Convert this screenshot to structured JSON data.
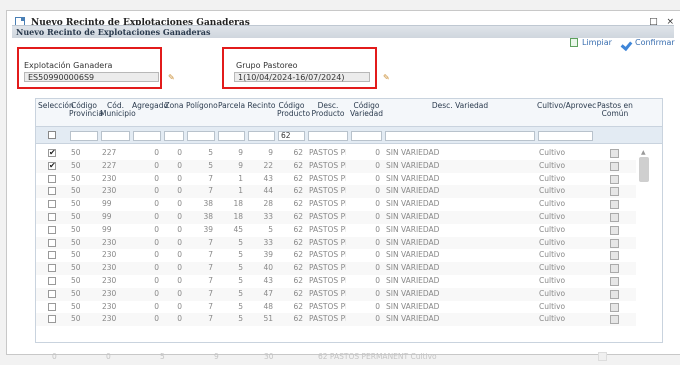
{
  "window": {
    "title": "Nuevo Recinto de Explotaciones Ganaderas",
    "controls": "_ □ ×"
  },
  "toolbar": {
    "title": "Nuevo Recinto de Explotaciones Ganaderas",
    "limpiar_label": "Limpiar",
    "confirmar_label": "Confirmar"
  },
  "form": {
    "explotacion_label": "Explotación Ganadera",
    "explotacion_value": "ES509900006S9",
    "grupo_label": "Grupo Pastoreo",
    "grupo_value": "1(10/04/2024-16/07/2024)"
  },
  "grid": {
    "columns": [
      {
        "key": "sel",
        "label": "Selección"
      },
      {
        "key": "prov",
        "label": "Código Provincia"
      },
      {
        "key": "mun",
        "label": "Cód. Municipio"
      },
      {
        "key": "agr",
        "label": "Agregado"
      },
      {
        "key": "zona",
        "label": "Zona"
      },
      {
        "key": "pol",
        "label": "Polígono"
      },
      {
        "key": "par",
        "label": "Parcela"
      },
      {
        "key": "rec",
        "label": "Recinto"
      },
      {
        "key": "cprod",
        "label": "Código Producto"
      },
      {
        "key": "dprod",
        "label": "Desc. Producto"
      },
      {
        "key": "cvar",
        "label": "Código Variedad"
      },
      {
        "key": "dvar",
        "label": "Desc. Variedad"
      },
      {
        "key": "cult",
        "label": "Cultivo/Aprovec"
      },
      {
        "key": "pastos",
        "label": "Pastos en Común"
      }
    ],
    "filter_producto": "62",
    "rows": [
      {
        "sel": true,
        "prov": "50",
        "mun": "227",
        "agr": "0",
        "zona": "0",
        "pol": "5",
        "par": "9",
        "rec": "9",
        "cprod": "62",
        "dprod": "PASTOS PEI",
        "cvar": "0",
        "dvar": "SIN VARIEDAD",
        "cult": "Cultivo"
      },
      {
        "sel": true,
        "prov": "50",
        "mun": "227",
        "agr": "0",
        "zona": "0",
        "pol": "5",
        "par": "9",
        "rec": "22",
        "cprod": "62",
        "dprod": "PASTOS PEI",
        "cvar": "0",
        "dvar": "SIN VARIEDAD",
        "cult": "Cultivo"
      },
      {
        "sel": false,
        "prov": "50",
        "mun": "230",
        "agr": "0",
        "zona": "0",
        "pol": "7",
        "par": "1",
        "rec": "43",
        "cprod": "62",
        "dprod": "PASTOS PEI",
        "cvar": "0",
        "dvar": "SIN VARIEDAD",
        "cult": "Cultivo"
      },
      {
        "sel": false,
        "prov": "50",
        "mun": "230",
        "agr": "0",
        "zona": "0",
        "pol": "7",
        "par": "1",
        "rec": "44",
        "cprod": "62",
        "dprod": "PASTOS PEI",
        "cvar": "0",
        "dvar": "SIN VARIEDAD",
        "cult": "Cultivo"
      },
      {
        "sel": false,
        "prov": "50",
        "mun": "99",
        "agr": "0",
        "zona": "0",
        "pol": "38",
        "par": "18",
        "rec": "28",
        "cprod": "62",
        "dprod": "PASTOS PEI",
        "cvar": "0",
        "dvar": "SIN VARIEDAD",
        "cult": "Cultivo"
      },
      {
        "sel": false,
        "prov": "50",
        "mun": "99",
        "agr": "0",
        "zona": "0",
        "pol": "38",
        "par": "18",
        "rec": "33",
        "cprod": "62",
        "dprod": "PASTOS PEI",
        "cvar": "0",
        "dvar": "SIN VARIEDAD",
        "cult": "Cultivo"
      },
      {
        "sel": false,
        "prov": "50",
        "mun": "99",
        "agr": "0",
        "zona": "0",
        "pol": "39",
        "par": "45",
        "rec": "5",
        "cprod": "62",
        "dprod": "PASTOS PEI",
        "cvar": "0",
        "dvar": "SIN VARIEDAD",
        "cult": "Cultivo"
      },
      {
        "sel": false,
        "prov": "50",
        "mun": "230",
        "agr": "0",
        "zona": "0",
        "pol": "7",
        "par": "5",
        "rec": "33",
        "cprod": "62",
        "dprod": "PASTOS PEI",
        "cvar": "0",
        "dvar": "SIN VARIEDAD",
        "cult": "Cultivo"
      },
      {
        "sel": false,
        "prov": "50",
        "mun": "230",
        "agr": "0",
        "zona": "0",
        "pol": "7",
        "par": "5",
        "rec": "39",
        "cprod": "62",
        "dprod": "PASTOS PEI",
        "cvar": "0",
        "dvar": "SIN VARIEDAD",
        "cult": "Cultivo"
      },
      {
        "sel": false,
        "prov": "50",
        "mun": "230",
        "agr": "0",
        "zona": "0",
        "pol": "7",
        "par": "5",
        "rec": "40",
        "cprod": "62",
        "dprod": "PASTOS PEI",
        "cvar": "0",
        "dvar": "SIN VARIEDAD",
        "cult": "Cultivo"
      },
      {
        "sel": false,
        "prov": "50",
        "mun": "230",
        "agr": "0",
        "zona": "0",
        "pol": "7",
        "par": "5",
        "rec": "43",
        "cprod": "62",
        "dprod": "PASTOS PEI",
        "cvar": "0",
        "dvar": "SIN VARIEDAD",
        "cult": "Cultivo"
      },
      {
        "sel": false,
        "prov": "50",
        "mun": "230",
        "agr": "0",
        "zona": "0",
        "pol": "7",
        "par": "5",
        "rec": "47",
        "cprod": "62",
        "dprod": "PASTOS PEI",
        "cvar": "0",
        "dvar": "SIN VARIEDAD",
        "cult": "Cultivo"
      },
      {
        "sel": false,
        "prov": "50",
        "mun": "230",
        "agr": "0",
        "zona": "0",
        "pol": "7",
        "par": "5",
        "rec": "48",
        "cprod": "62",
        "dprod": "PASTOS PEI",
        "cvar": "0",
        "dvar": "SIN VARIEDAD",
        "cult": "Cultivo"
      },
      {
        "sel": false,
        "prov": "50",
        "mun": "230",
        "agr": "0",
        "zona": "0",
        "pol": "7",
        "par": "5",
        "rec": "51",
        "cprod": "62",
        "dprod": "PASTOS PEI",
        "cvar": "0",
        "dvar": "SIN VARIEDAD",
        "cult": "Cultivo"
      }
    ],
    "ghost_row": {
      "a": "0",
      "b": "0",
      "c": "5",
      "d": "9",
      "e": "30",
      "f": "62  PASTOS PERMANENT Cultivo"
    }
  },
  "colors": {
    "highlight": "#e21b1b",
    "accent": "#3f86d8"
  }
}
